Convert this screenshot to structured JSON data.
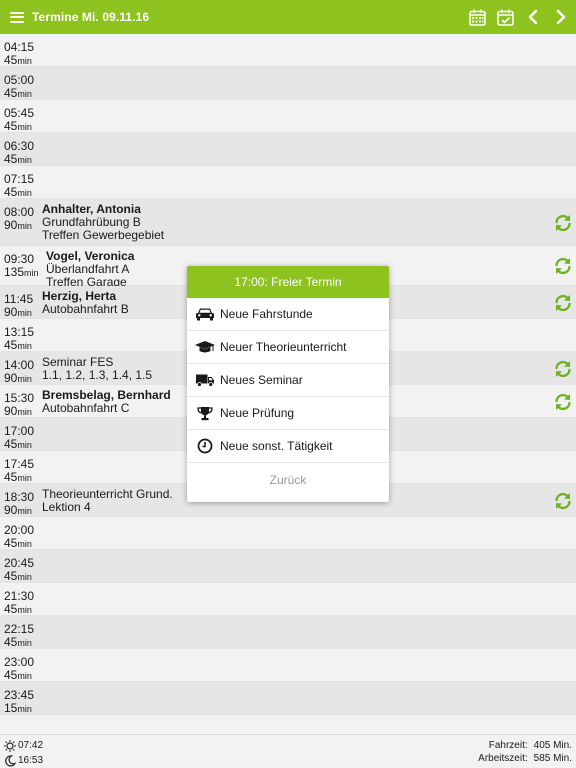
{
  "header": {
    "title": "Termine Mi. 09.11.16"
  },
  "colors": {
    "accent": "#8dc21f",
    "refresh": "#6db31f"
  },
  "slots": [
    {
      "time": "04:15",
      "dur": "45",
      "unit": "min"
    },
    {
      "time": "05:00",
      "dur": "45",
      "unit": "min"
    },
    {
      "time": "05:45",
      "dur": "45",
      "unit": "min"
    },
    {
      "time": "06:30",
      "dur": "45",
      "unit": "min"
    },
    {
      "time": "07:15",
      "dur": "45",
      "unit": "min"
    },
    {
      "time": "08:00",
      "dur": "90",
      "unit": "min",
      "name": "Anhalter, Antonia",
      "lines": [
        "Grundfahrübung B",
        "Treffen Gewerbegebiet"
      ]
    },
    {
      "time": "09:30",
      "dur": "135",
      "unit": "min",
      "name": "Vogel, Veronica",
      "lines": [
        "Überlandfahrt A",
        "Treffen Garage"
      ]
    },
    {
      "time": "11:45",
      "dur": "90",
      "unit": "min",
      "name": "Herzig, Herta",
      "lines": [
        "Autobahnfahrt B"
      ]
    },
    {
      "time": "13:15",
      "dur": "45",
      "unit": "min"
    },
    {
      "time": "14:00",
      "dur": "90",
      "unit": "min",
      "lines": [
        "Seminar FES",
        "1.1, 1.2, 1.3, 1.4, 1.5"
      ]
    },
    {
      "time": "15:30",
      "dur": "90",
      "unit": "min",
      "name": "Bremsbelag, Bernhard",
      "lines": [
        "Autobahnfahrt C"
      ]
    },
    {
      "time": "17:00",
      "dur": "45",
      "unit": "min"
    },
    {
      "time": "17:45",
      "dur": "45",
      "unit": "min"
    },
    {
      "time": "18:30",
      "dur": "90",
      "unit": "min",
      "lines": [
        "Theorieunterricht Grund.",
        "Lektion 4"
      ]
    },
    {
      "time": "20:00",
      "dur": "45",
      "unit": "min"
    },
    {
      "time": "20:45",
      "dur": "45",
      "unit": "min"
    },
    {
      "time": "21:30",
      "dur": "45",
      "unit": "min"
    },
    {
      "time": "22:15",
      "dur": "45",
      "unit": "min"
    },
    {
      "time": "23:00",
      "dur": "45",
      "unit": "min"
    },
    {
      "time": "23:45",
      "dur": "15",
      "unit": "min"
    }
  ],
  "popup": {
    "title": "17:00: Freier Termin",
    "items": [
      {
        "label": "Neue Fahrstunde",
        "icon": "car-icon"
      },
      {
        "label": "Neuer Theorieunterricht",
        "icon": "graduation-cap-icon"
      },
      {
        "label": "Neues Seminar",
        "icon": "truck-icon"
      },
      {
        "label": "Neue Prüfung",
        "icon": "trophy-icon"
      },
      {
        "label": "Neue sonst. Tätigkeit",
        "icon": "clock-icon"
      }
    ],
    "back": "Zurück"
  },
  "footer": {
    "sunrise": "07:42",
    "sunset": "16:53",
    "fahrzeit_label": "Fahrzeit:",
    "fahrzeit_value": "405 Min.",
    "arbeitszeit_label": "Arbeitszeit:",
    "arbeitszeit_value": "585 Min."
  }
}
